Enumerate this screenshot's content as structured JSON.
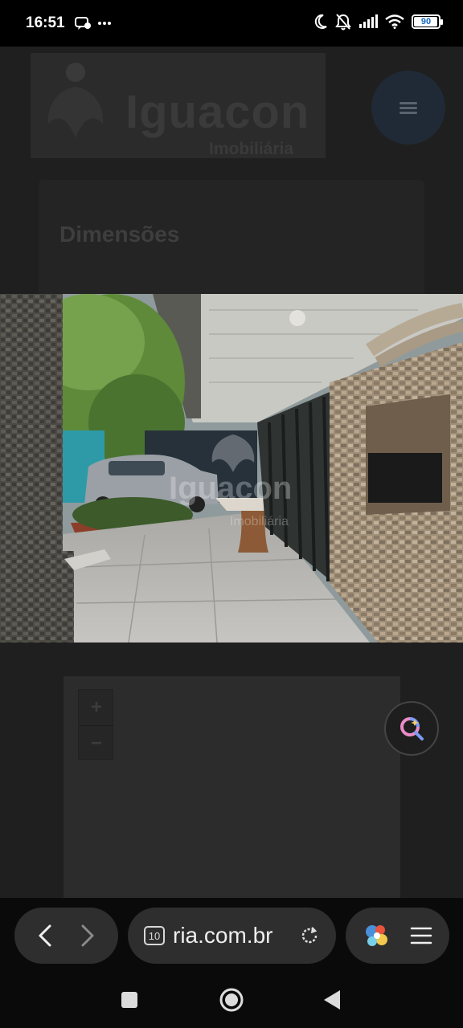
{
  "status_bar": {
    "time": "16:51",
    "battery_level": "90",
    "icons": [
      "chat-icon",
      "more-icon",
      "moon-icon",
      "bell-off-icon",
      "signal-icon",
      "wifi-icon",
      "battery-icon"
    ]
  },
  "site": {
    "logo_name": "Iguacon",
    "logo_sub": "Imobiliária",
    "section_title": "Dimensões",
    "map_zoom_in": "+",
    "map_zoom_out": "−"
  },
  "browser": {
    "url": "ria.com.br",
    "tab_count": "10"
  },
  "colors": {
    "accent_blue": "#1565c0",
    "page_dim": "#1f1f1f",
    "pill": "#2e2e2e"
  }
}
